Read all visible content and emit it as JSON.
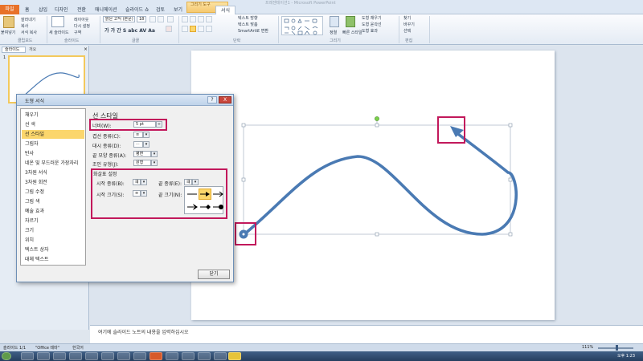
{
  "window": {
    "title": "프레젠테이션1 - Microsoft PowerPoint"
  },
  "ribbon_tabs": [
    "파일",
    "홈",
    "삽입",
    "디자인",
    "전환",
    "애니메이션",
    "슬라이드 쇼",
    "검토",
    "보기",
    "서식"
  ],
  "context_tab": "그리기 도구",
  "ribbon": {
    "clipboard": {
      "paste": "붙여넣기",
      "cut": "잘라내기",
      "copy": "복사",
      "format_painter": "서식 복사",
      "label": "클립보드"
    },
    "slides": {
      "new_slide": "새 슬라이드",
      "layout": "레이아웃",
      "reset": "다시 설정",
      "section": "구역",
      "label": "슬라이드"
    },
    "font": {
      "name": "맑은 고딕 (본문)",
      "size": "18",
      "label": "글꼴"
    },
    "paragraph": {
      "text_direction": "텍스트 방향",
      "align_text": "텍스트 맞춤",
      "smartart": "SmartArt로 변환",
      "label": "단락"
    },
    "drawing": {
      "arrange": "정렬",
      "quick_styles": "빠른 스타일",
      "fill": "도형 채우기",
      "outline": "도형 윤곽선",
      "effects": "도형 효과",
      "label": "그리기"
    },
    "editing": {
      "find": "찾기",
      "replace": "바꾸기",
      "select": "선택",
      "label": "편집"
    }
  },
  "left_pane": {
    "tab_slides": "슬라이드",
    "tab_outline": "개요",
    "close": "×",
    "thumb_number": "1"
  },
  "dialog": {
    "title": "도형 서식",
    "help": "?",
    "close": "X",
    "categories": [
      "채우기",
      "선 색",
      "선 스타일",
      "그림자",
      "반사",
      "네온 및 부드러운 가장자리",
      "3차원 서식",
      "3차원 회전",
      "그림 수정",
      "그림 색",
      "예술 효과",
      "자르기",
      "크기",
      "위치",
      "텍스트 상자",
      "대체 텍스트"
    ],
    "selected_category": 2,
    "section_title": "선 스타일",
    "width_label": "너비(W):",
    "width_value": "5 pt",
    "compound_label": "겹선 종류(C):",
    "dash_label": "대시 종류(D):",
    "cap_label": "끝 모양 종류(A):",
    "cap_value": "평면",
    "join_label": "조인 유형(J):",
    "join_value": "원형",
    "arrow_section": "화살표 설정",
    "begin_type_label": "시작 종류(B):",
    "end_type_label": "끝 종류(E):",
    "begin_size_label": "시작 크기(S):",
    "end_size_label": "끝 크기(N):",
    "close_button": "닫기"
  },
  "notes": {
    "placeholder": "여기에 슬라이드 노트의 내용을 입력하십시오"
  },
  "status": {
    "slide": "슬라이드 1/1",
    "theme": "\"Office 테마\"",
    "language": "한국어",
    "zoom": "111%",
    "time": "오후 1:23"
  },
  "colors": {
    "accent": "#4a7ab3",
    "highlight": "#c2185b",
    "selection": "#fbd66c",
    "file_tab": "#e8722a"
  }
}
